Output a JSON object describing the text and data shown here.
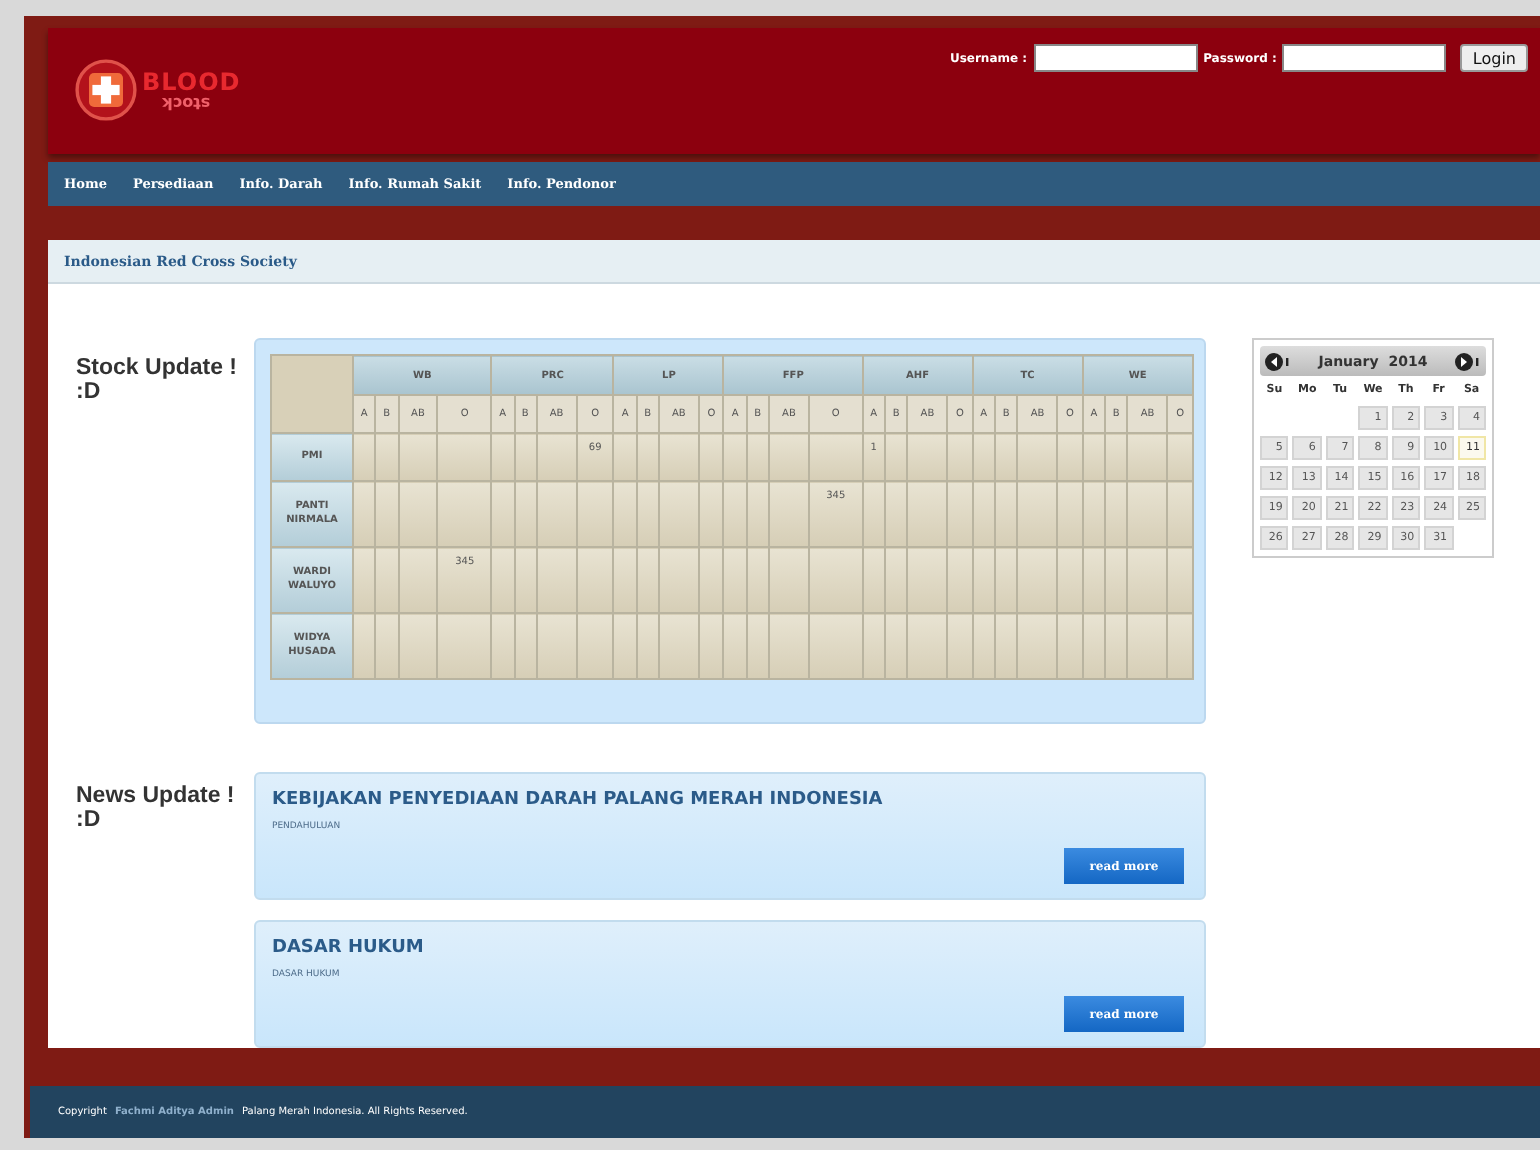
{
  "header": {
    "logo": {
      "word": "BLOOD",
      "reflection": "stock"
    },
    "login": {
      "username_label": "Username :",
      "password_label": "Password :",
      "button": "Login"
    }
  },
  "nav": [
    {
      "label": "Home"
    },
    {
      "label": "Persediaan"
    },
    {
      "label": "Info. Darah"
    },
    {
      "label": "Info. Rumah Sakit"
    },
    {
      "label": "Info. Pendonor"
    }
  ],
  "content_title": "Indonesian Red Cross Society",
  "stock": {
    "heading": "Stock Update ! :D",
    "groups": [
      {
        "name": "WB",
        "types": [
          "A",
          "B",
          "AB",
          "O"
        ]
      },
      {
        "name": "PRC",
        "types": [
          "A",
          "B",
          "AB",
          "O"
        ]
      },
      {
        "name": "LP",
        "types": [
          "A",
          "B",
          "AB",
          "O"
        ]
      },
      {
        "name": "FFP",
        "types": [
          "A",
          "B",
          "AB",
          "O"
        ]
      },
      {
        "name": "AHF",
        "types": [
          "A",
          "B",
          "AB",
          "O"
        ]
      },
      {
        "name": "TC",
        "types": [
          "A",
          "B",
          "AB",
          "O"
        ]
      },
      {
        "name": "WE",
        "types": [
          "A",
          "B",
          "AB",
          "O"
        ]
      }
    ],
    "rows": [
      {
        "name": "PMI",
        "cells": [
          null,
          null,
          null,
          null,
          null,
          null,
          null,
          "69",
          null,
          null,
          null,
          null,
          null,
          null,
          null,
          null,
          "1",
          null,
          null,
          null,
          null,
          null,
          null,
          null,
          null,
          null,
          null,
          null
        ]
      },
      {
        "name": "PANTI NIRMALA",
        "cells": [
          null,
          null,
          null,
          null,
          null,
          null,
          null,
          null,
          null,
          null,
          null,
          null,
          null,
          null,
          null,
          "345",
          null,
          null,
          null,
          null,
          null,
          null,
          null,
          null,
          null,
          null,
          null,
          null
        ]
      },
      {
        "name": "WARDI WALUYO",
        "cells": [
          null,
          null,
          null,
          "345",
          null,
          null,
          null,
          null,
          null,
          null,
          null,
          null,
          null,
          null,
          null,
          null,
          null,
          null,
          null,
          null,
          null,
          null,
          null,
          null,
          null,
          null,
          null,
          null
        ]
      },
      {
        "name": "WIDYA HUSADA",
        "cells": [
          null,
          null,
          null,
          null,
          null,
          null,
          null,
          null,
          null,
          null,
          null,
          null,
          null,
          null,
          null,
          null,
          null,
          null,
          null,
          null,
          null,
          null,
          null,
          null,
          null,
          null,
          null,
          null
        ]
      }
    ]
  },
  "calendar": {
    "month": "January",
    "year": "2014",
    "weekdays": [
      "Su",
      "Mo",
      "Tu",
      "We",
      "Th",
      "Fr",
      "Sa"
    ],
    "weeks": [
      [
        {
          "day": "1",
          "today": false
        },
        {
          "day": "2",
          "today": false
        },
        {
          "day": "3",
          "today": false
        },
        {
          "day": "4",
          "today": false
        }
      ],
      [
        {
          "day": "5",
          "today": false
        },
        {
          "day": "6",
          "today": false
        },
        {
          "day": "7",
          "today": false
        },
        {
          "day": "8",
          "today": false
        },
        {
          "day": "9",
          "today": false
        },
        {
          "day": "10",
          "today": false
        },
        {
          "day": "11",
          "today": true
        }
      ],
      [
        {
          "day": "12",
          "today": false
        },
        {
          "day": "13",
          "today": false
        },
        {
          "day": "14",
          "today": false
        },
        {
          "day": "15",
          "today": false
        },
        {
          "day": "16",
          "today": false
        },
        {
          "day": "17",
          "today": false
        },
        {
          "day": "18",
          "today": false
        }
      ],
      [
        {
          "day": "19",
          "today": false
        },
        {
          "day": "20",
          "today": false
        },
        {
          "day": "21",
          "today": false
        },
        {
          "day": "22",
          "today": false
        },
        {
          "day": "23",
          "today": false
        },
        {
          "day": "24",
          "today": false
        },
        {
          "day": "25",
          "today": false
        }
      ],
      [
        {
          "day": "26",
          "today": false
        },
        {
          "day": "27",
          "today": false
        },
        {
          "day": "28",
          "today": false
        },
        {
          "day": "29",
          "today": false
        },
        {
          "day": "30",
          "today": false
        },
        {
          "day": "31",
          "today": false
        }
      ]
    ]
  },
  "news": {
    "heading": "News Update ! :D",
    "items": [
      {
        "title": "KEBIJAKAN PENYEDIAAN DARAH PALANG MERAH INDONESIA",
        "summary": "PENDAHULUAN",
        "button": "read more"
      },
      {
        "title": "DASAR HUKUM",
        "summary": "DASAR HUKUM",
        "button": "read more"
      }
    ]
  },
  "footer": {
    "prefix": "Copyright",
    "author": "Fachmi Aditya Admin",
    "suffix": "Palang Merah Indonesia. All Rights Reserved."
  }
}
